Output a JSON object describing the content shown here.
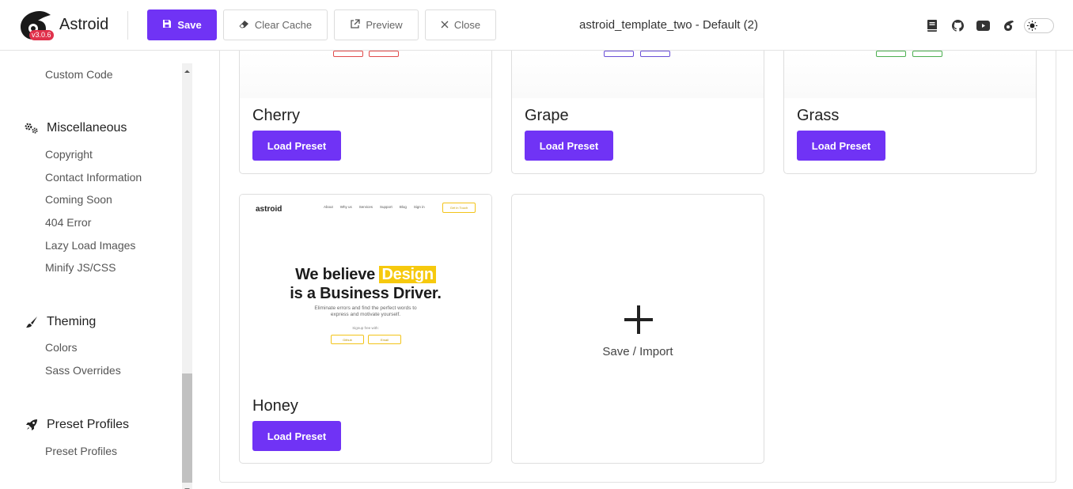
{
  "app": {
    "name": "Astroid",
    "version": "v3.0.6",
    "brand_color": "#7033f5",
    "badge_color": "#e0314b"
  },
  "toolbar": {
    "save_label": "Save",
    "clear_cache_label": "Clear Cache",
    "preview_label": "Preview",
    "close_label": "Close",
    "document_title": "astroid_template_two - Default (2)",
    "icons": [
      "book-icon",
      "github-icon",
      "youtube-icon",
      "astroid-icon"
    ],
    "theme_toggle_icon": "sun-icon"
  },
  "sidebar": {
    "top_item": "Custom Code",
    "sections": [
      {
        "title": "Miscellaneous",
        "icon": "cogs-icon",
        "items": [
          "Copyright",
          "Contact Information",
          "Coming Soon",
          "404 Error",
          "Lazy Load Images",
          "Minify JS/CSS"
        ]
      },
      {
        "title": "Theming",
        "icon": "paintbrush-icon",
        "items": [
          "Colors",
          "Sass Overrides"
        ]
      },
      {
        "title": "Preset Profiles",
        "icon": "rocket-icon",
        "items": [
          "Preset Profiles"
        ]
      }
    ]
  },
  "presets": {
    "load_label": "Load Preset",
    "cards": [
      {
        "name": "Cherry",
        "accent": "#e04b4b"
      },
      {
        "name": "Grape",
        "accent": "#6a4fd6"
      },
      {
        "name": "Grass",
        "accent": "#4caf50"
      },
      {
        "name": "Honey",
        "accent": "#f6c90e"
      }
    ],
    "honey_preview": {
      "logo": "astroid",
      "nav": [
        "About",
        "Why us",
        "Services",
        "Support",
        "Blog",
        "Sign in"
      ],
      "cta": "Get in Touch",
      "headline_1_pre": "We believe ",
      "headline_1_highlight": "Design",
      "headline_2": "is a Business Driver.",
      "subtitle_1": "Eliminate errors and find the perfect words to",
      "subtitle_2": "express and motivate yourself.",
      "signup": "Signup free with:",
      "buttons": [
        "Github",
        "Email"
      ]
    },
    "import_label": "Save / Import"
  }
}
